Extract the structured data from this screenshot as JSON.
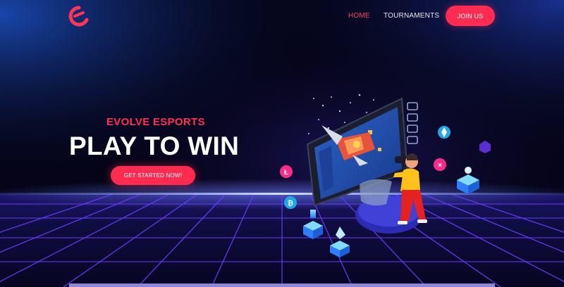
{
  "nav": {
    "links": [
      {
        "label": "HOME",
        "active": true
      },
      {
        "label": "TOURNAMENTS",
        "active": false
      }
    ],
    "cta_label": "JOIN US"
  },
  "hero": {
    "eyebrow": "EVOLVE ESPORTS",
    "headline": "PLAY TO WIN",
    "button_label": "GET STARTED NOW!"
  },
  "colors": {
    "accent": "#ff2b51",
    "background": "#050418",
    "grid": "#6a3cff",
    "horizon": "#a7b4ff"
  },
  "icons": [
    "logo-icon",
    "litecoin-icon",
    "bitcoin-icon",
    "ethereum-icon",
    "xrp-icon",
    "vr-player-illustration",
    "phone-illustration",
    "spaceship-illustration"
  ]
}
